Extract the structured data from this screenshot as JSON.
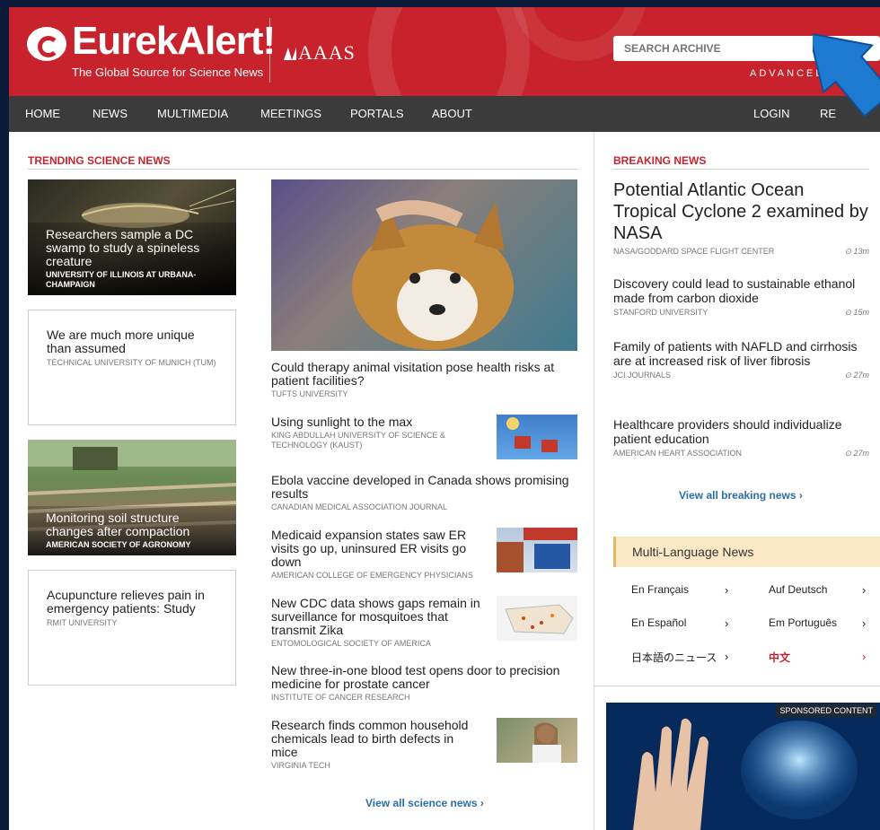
{
  "header": {
    "logo_text": "EurekAlert!",
    "tagline": "The Global Source for Science News",
    "partner": "AAAS",
    "search_placeholder": "SEARCH ARCHIVE",
    "advanced_label": "ADVANCED"
  },
  "nav": {
    "items": [
      "HOME",
      "NEWS",
      "MULTIMEDIA",
      "MEETINGS",
      "PORTALS",
      "ABOUT"
    ],
    "login": "LOGIN",
    "register": "RE"
  },
  "trending": {
    "heading": "TRENDING SCIENCE NEWS",
    "left": [
      {
        "title": "Researchers sample a DC swamp to study a spineless creature",
        "source": "UNIVERSITY OF ILLINOIS AT URBANA-CHAMPAIGN"
      },
      {
        "title": "We are much more unique than assumed",
        "source": "TECHNICAL UNIVERSITY OF MUNICH (TUM)"
      },
      {
        "title": "Monitoring soil structure changes after compaction",
        "source": "AMERICAN SOCIETY OF AGRONOMY"
      },
      {
        "title": "Acupuncture relieves pain in emergency patients: Study",
        "source": "RMIT UNIVERSITY"
      }
    ],
    "feature": {
      "title": "Could therapy animal visitation pose health risks at patient facilities?",
      "source": "TUFTS UNIVERSITY"
    },
    "stories": [
      {
        "title": "Using sunlight to the max",
        "source": "KING ABDULLAH UNIVERSITY OF SCIENCE & TECHNOLOGY (KAUST)"
      },
      {
        "title": "Ebola vaccine developed in Canada shows promising results",
        "source": "CANADIAN MEDICAL ASSOCIATION JOURNAL"
      },
      {
        "title": "Medicaid expansion states saw ER visits go up, uninsured ER visits go down",
        "source": "AMERICAN COLLEGE OF EMERGENCY PHYSICIANS"
      },
      {
        "title": "New CDC data shows gaps remain in surveillance for mosquitoes that transmit Zika",
        "source": "ENTOMOLOGICAL SOCIETY OF AMERICA"
      },
      {
        "title": "New three-in-one blood test opens door to precision medicine for prostate cancer",
        "source": "INSTITUTE OF CANCER RESEARCH"
      },
      {
        "title": "Research finds common household chemicals lead to birth defects in mice",
        "source": "VIRGINIA TECH"
      }
    ],
    "view_all": "View all science news ›"
  },
  "breaking": {
    "heading": "BREAKING NEWS",
    "items": [
      {
        "title": "Potential Atlantic Ocean Tropical Cyclone 2 examined by NASA",
        "source": "NASA/GODDARD SPACE FLIGHT CENTER",
        "time": "13m"
      },
      {
        "title": "Discovery could lead to sustainable ethanol made from carbon dioxide",
        "source": "STANFORD UNIVERSITY",
        "time": "15m"
      },
      {
        "title": "Family of patients with NAFLD and cirrhosis are at increased risk of liver fibrosis",
        "source": "JCI JOURNALS",
        "time": "27m"
      },
      {
        "title": "Healthcare providers should individualize patient education",
        "source": "AMERICAN HEART ASSOCIATION",
        "time": "27m"
      }
    ],
    "view_all": "View all breaking news ›"
  },
  "multilang": {
    "heading": "Multi-Language News",
    "langs": [
      "En Français",
      "Auf Deutsch",
      "En Español",
      "Em Português",
      "日本語のニュース",
      "中文"
    ]
  },
  "sponsored": {
    "label": "SPONSORED CONTENT"
  },
  "colors": {
    "brand_red": "#c8232c",
    "nav_bg": "#3b3b3b",
    "link_blue": "#2a6fa8",
    "multilang_bg": "#fbe9c6"
  },
  "icons": {
    "clock": "clock-icon",
    "chevron": "chevron-right-icon"
  }
}
